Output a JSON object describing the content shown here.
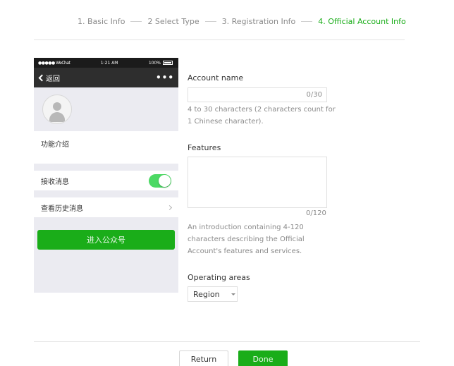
{
  "steps": [
    {
      "label": "1. Basic Info",
      "active": false
    },
    {
      "label": "2 Select Type",
      "active": false
    },
    {
      "label": "3. Registration Info",
      "active": false
    },
    {
      "label": "4. Official Account Info",
      "active": true
    }
  ],
  "phone": {
    "status": {
      "carrier": "●●●●● WeChat",
      "time": "1:21 AM",
      "battery": "100%"
    },
    "nav": {
      "back_label": "返回",
      "more_label": "•••"
    },
    "intro_label": "功能介绍",
    "receive_label": "接收消息",
    "receive_enabled": true,
    "history_label": "查看历史消息",
    "enter_button": "进入公众号"
  },
  "form": {
    "account_name": {
      "label": "Account name",
      "value": "",
      "counter": "0/30",
      "hint": "4 to 30 characters (2 characters count for 1 Chinese character)."
    },
    "features": {
      "label": "Features",
      "value": "",
      "counter": "0/120",
      "hint": "An introduction containing 4-120 characters describing the Official Account's features and services."
    },
    "operating_areas": {
      "label": "Operating areas",
      "selected": "Region"
    }
  },
  "actions": {
    "return_label": "Return",
    "done_label": "Done"
  },
  "colors": {
    "accent": "#1aad19",
    "toggle_on": "#4cd964",
    "nav_bg": "#2e2e2e"
  }
}
